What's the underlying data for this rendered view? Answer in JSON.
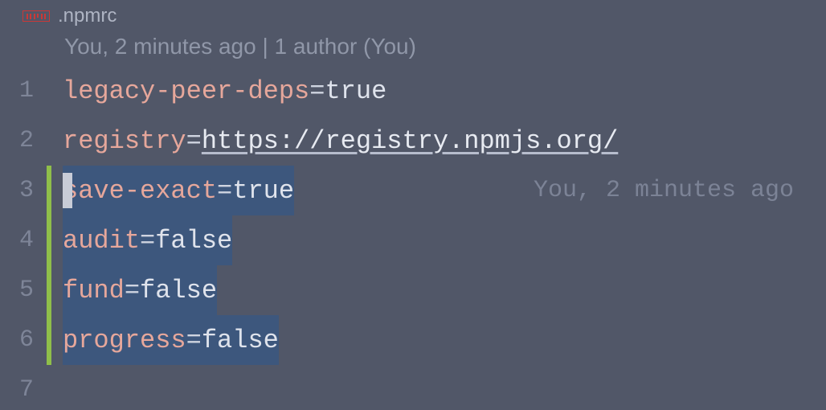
{
  "tab": {
    "filename": ".npmrc",
    "icon_name": "npm-icon"
  },
  "codelens": {
    "text": "You, 2 minutes ago | 1 author (You)"
  },
  "inline_blame": {
    "text": "You, 2 minutes ago "
  },
  "lines": [
    {
      "num": "1",
      "key": "legacy-peer-deps",
      "eq": "=",
      "val": "true",
      "url": false,
      "modified": false,
      "selected": false,
      "cursor": false
    },
    {
      "num": "2",
      "key": "registry",
      "eq": "=",
      "val": "https://registry.npmjs.org/",
      "url": true,
      "modified": false,
      "selected": false,
      "cursor": false
    },
    {
      "num": "3",
      "key": "save-exact",
      "eq": "=",
      "val": "true",
      "url": false,
      "modified": true,
      "selected": true,
      "cursor": true,
      "blame": true
    },
    {
      "num": "4",
      "key": "audit",
      "eq": "=",
      "val": "false",
      "url": false,
      "modified": true,
      "selected": true,
      "cursor": false
    },
    {
      "num": "5",
      "key": "fund",
      "eq": "=",
      "val": "false",
      "url": false,
      "modified": true,
      "selected": true,
      "cursor": false
    },
    {
      "num": "6",
      "key": "progress",
      "eq": "=",
      "val": "false",
      "url": false,
      "modified": true,
      "selected": true,
      "cursor": false
    },
    {
      "num": "7",
      "key": "",
      "eq": "",
      "val": "",
      "url": false,
      "modified": false,
      "selected": false,
      "cursor": false
    }
  ]
}
